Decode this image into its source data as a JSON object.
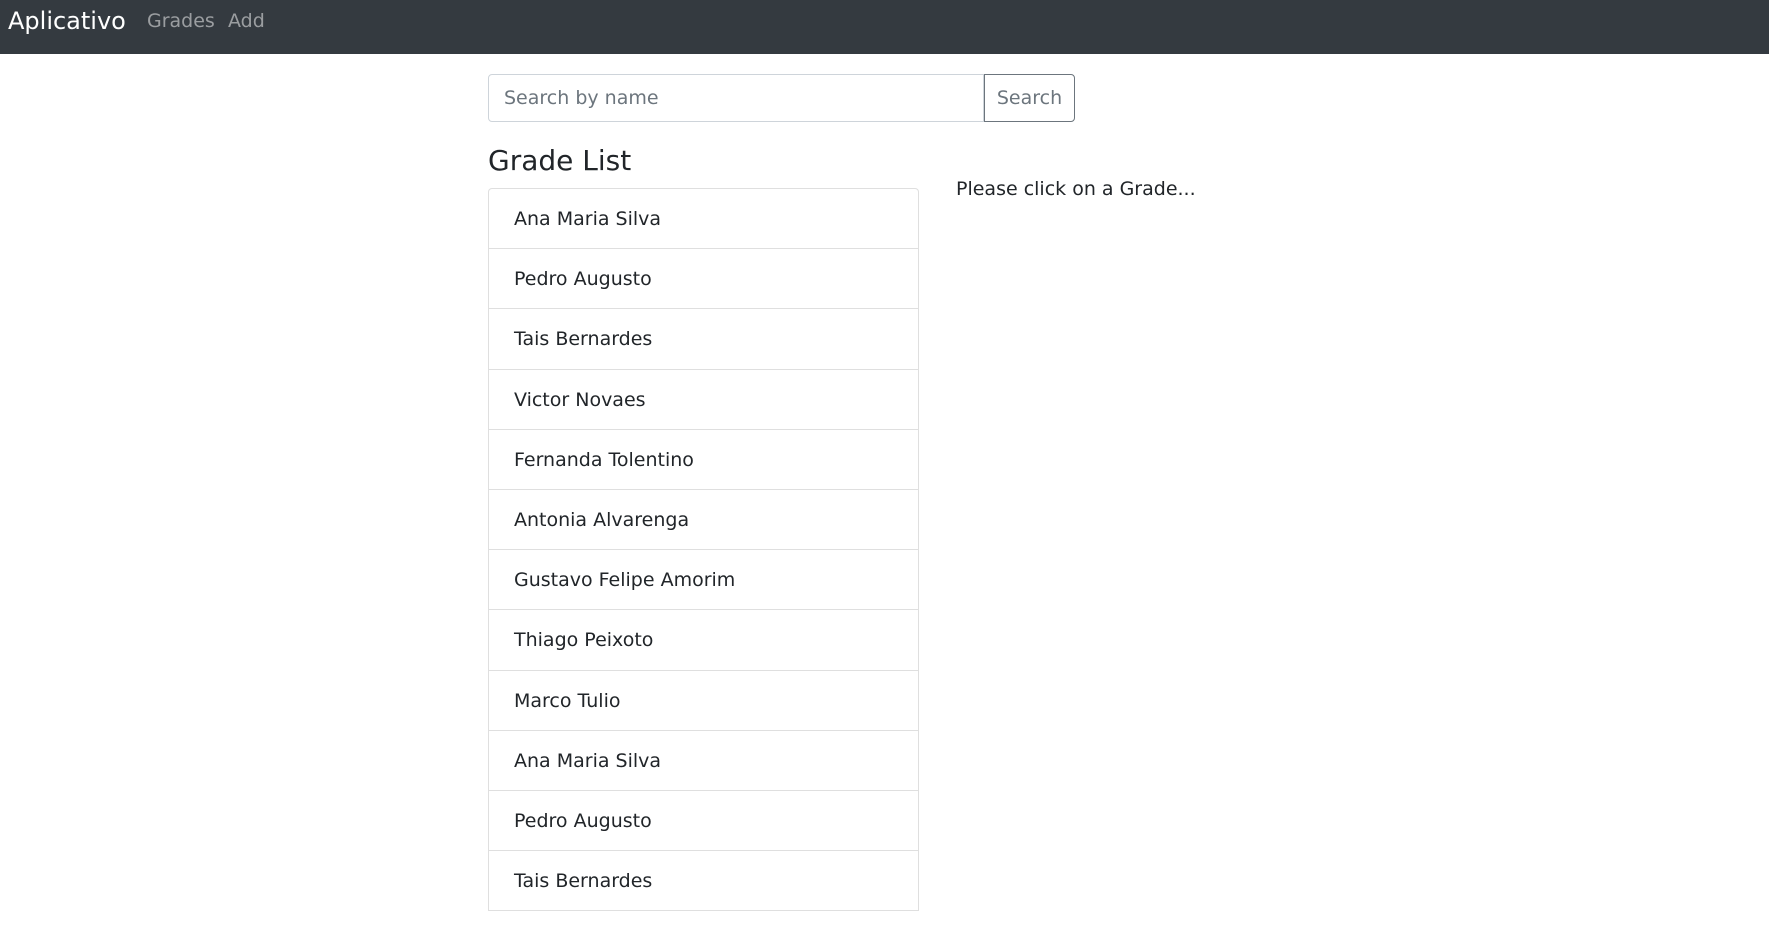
{
  "navbar": {
    "brand": "Aplicativo",
    "links": [
      "Grades",
      "Add"
    ]
  },
  "search": {
    "placeholder": "Search by name",
    "value": "",
    "button_label": "Search"
  },
  "list": {
    "title": "Grade List",
    "items": [
      "Ana Maria Silva",
      "Pedro Augusto",
      "Tais Bernardes",
      "Victor Novaes",
      "Fernanda Tolentino",
      "Antonia Alvarenga",
      "Gustavo Felipe Amorim",
      "Thiago Peixoto",
      "Marco Tulio",
      "Ana Maria Silva",
      "Pedro Augusto",
      "Tais Bernardes"
    ]
  },
  "detail": {
    "hint": "Please click on a Grade..."
  },
  "colors": {
    "navbar_bg": "#343a40",
    "nav_link": "#9a9da0",
    "border": "#dfdfdf",
    "button_outline": "#6c757d"
  }
}
